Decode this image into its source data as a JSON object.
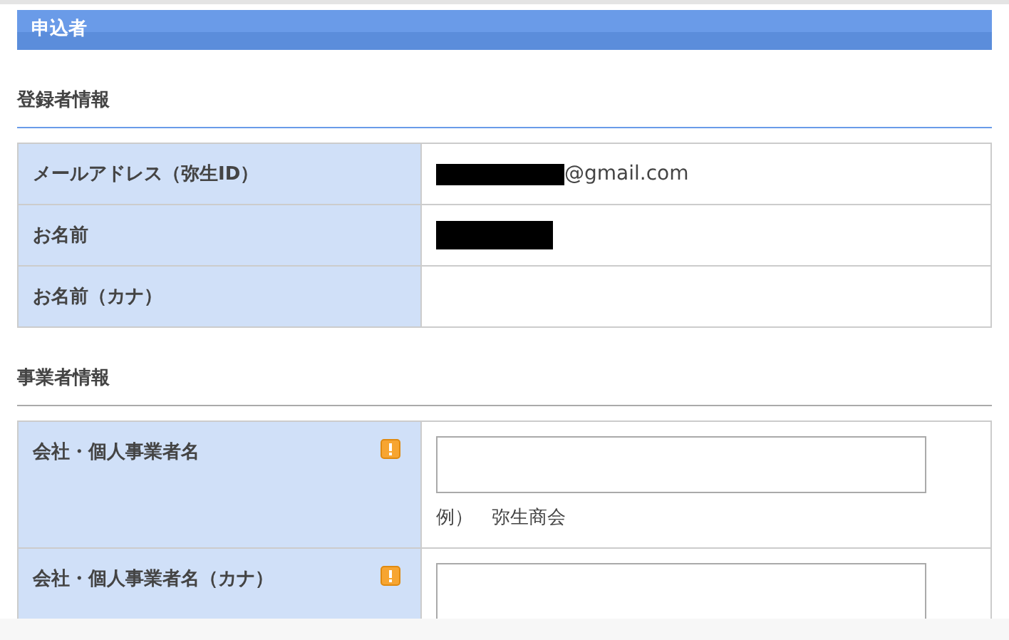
{
  "section_header": {
    "title": "申込者"
  },
  "sections": [
    {
      "title": "登録者情報",
      "color": "#6a9be8",
      "rows": [
        {
          "label": "メールアドレス（弥生ID）",
          "kind": "text",
          "redacted": true,
          "value": "@gmail.com"
        },
        {
          "label": "お名前",
          "kind": "text",
          "redacted": true
        },
        {
          "label": "お名前（カナ）",
          "kind": "text"
        }
      ]
    },
    {
      "title": "事業者情報",
      "color": "#aaaaaa",
      "rows": [
        {
          "label": "会社・個人事業者名",
          "kind": "input",
          "required": true,
          "example": "例）　弥生商会"
        },
        {
          "label": "会社・個人事業者名（カナ）",
          "kind": "input",
          "required": true
        }
      ]
    }
  ]
}
